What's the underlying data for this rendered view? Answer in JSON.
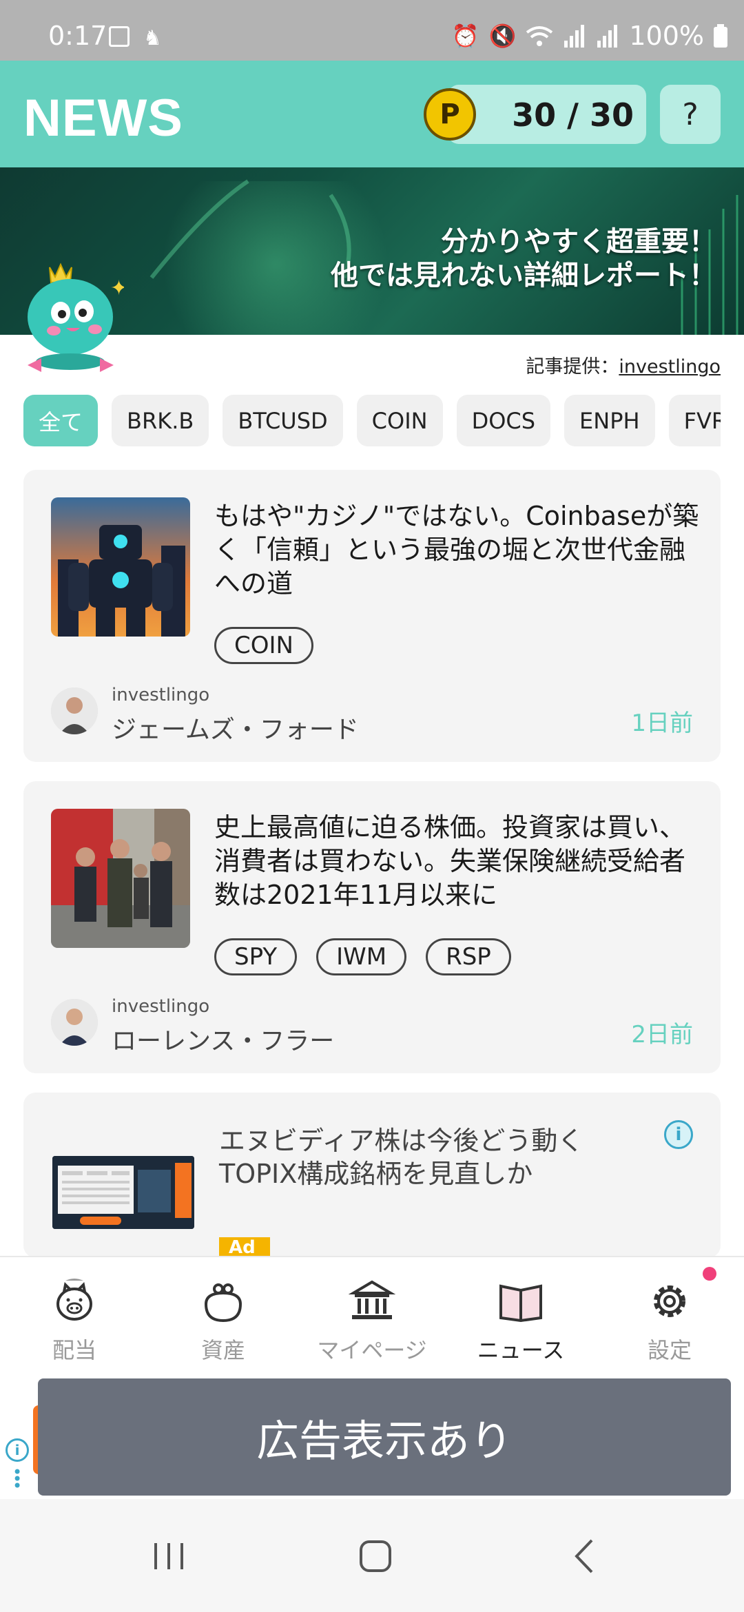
{
  "status_bar": {
    "time": "0:17",
    "battery": "100%"
  },
  "header": {
    "title": "NEWS",
    "points_icon_letter": "P",
    "points": "30 / 30",
    "help_label": "?"
  },
  "banner": {
    "line1": "分かりやすく超重要！",
    "line2": "他では見れない詳細レポート！"
  },
  "source": {
    "prefix": "記事提供：",
    "link": "investlingo"
  },
  "chips": [
    {
      "label": "全て",
      "active": true
    },
    {
      "label": "BRK.B"
    },
    {
      "label": "BTCUSD"
    },
    {
      "label": "COIN"
    },
    {
      "label": "DOCS"
    },
    {
      "label": "ENPH"
    },
    {
      "label": "FVR"
    }
  ],
  "articles": [
    {
      "title": "もはや\"カジノ\"ではない。Coinbaseが築く「信頼」という最強の堀と次世代金融への道",
      "tags": [
        "COIN"
      ],
      "source": "investlingo",
      "author": "ジェームズ・フォード",
      "age": "1日前"
    },
    {
      "title": "史上最高値に迫る株価。投資家は買い、消費者は買わない。失業保険継続受給者数は2021年11月以来に",
      "tags": [
        "SPY",
        "IWM",
        "RSP"
      ],
      "source": "investlingo",
      "author": "ローレンス・フラー",
      "age": "2日前"
    }
  ],
  "ad": {
    "title": "エヌビディア株は今後どう動く TOPIX構成銘柄を見直しか",
    "badge": "Ad",
    "info": "i"
  },
  "bottom_nav": [
    {
      "label": "配当",
      "icon": "piggy-bank-icon"
    },
    {
      "label": "資産",
      "icon": "purse-icon"
    },
    {
      "label": "マイページ",
      "icon": "bank-building-icon"
    },
    {
      "label": "ニュース",
      "icon": "book-icon",
      "active": true
    },
    {
      "label": "設定",
      "icon": "gear-icon",
      "badge": true
    }
  ],
  "ad_overlay": {
    "label": "広告表示あり"
  },
  "colors": {
    "accent": "#66d1bf",
    "notification": "#f0407a"
  }
}
